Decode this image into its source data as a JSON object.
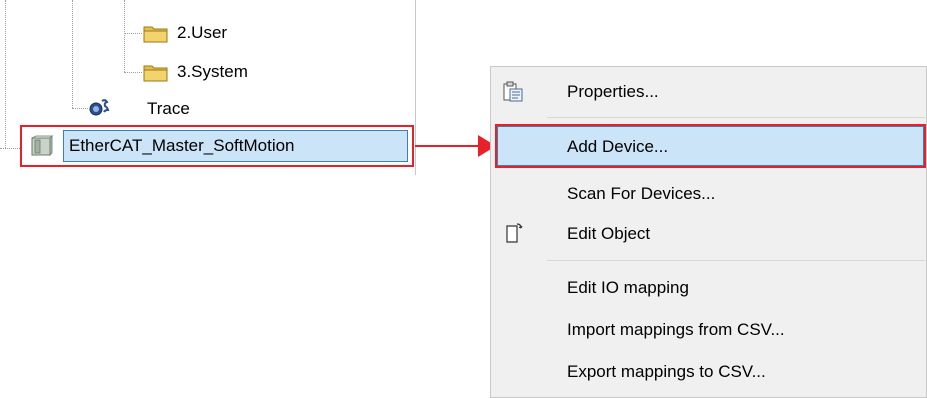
{
  "tree": {
    "items": [
      {
        "label": "2.User",
        "icon": "folder-icon"
      },
      {
        "label": "3.System",
        "icon": "folder-icon"
      },
      {
        "label": "Trace",
        "icon": "trace-icon"
      },
      {
        "label": "EtherCAT_Master_SoftMotion",
        "icon": "ethercat-device-icon"
      }
    ]
  },
  "context_menu": {
    "items": [
      {
        "label": "Properties...",
        "icon": "properties-icon"
      },
      {
        "label": "Add Device..."
      },
      {
        "label": "Scan For Devices..."
      },
      {
        "label": "Edit Object",
        "icon": "edit-object-icon"
      },
      {
        "label": "Edit IO mapping"
      },
      {
        "label": "Import mappings from CSV..."
      },
      {
        "label": "Export mappings to CSV..."
      }
    ]
  },
  "colors": {
    "annotation": "#e8202a",
    "selection": "#cce4f7",
    "selection_border": "#3c7fb1",
    "menu_background": "#f0f0f0"
  }
}
